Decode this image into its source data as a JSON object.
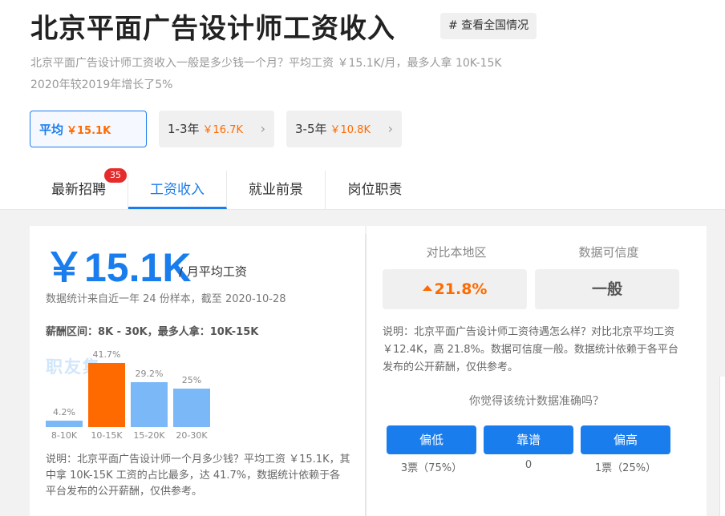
{
  "header": {
    "title": "北京平面广告设计师工资收入",
    "nation_tag": "# 查看全国情况",
    "desc_line1": "北京平面广告设计师工资收入一般是多少钱一个月？平均工资 ￥15.1K/月，最多人拿 10K-15K",
    "desc_line2": "2020年较2019年增长了5%"
  },
  "chips": [
    {
      "label": "平均",
      "value": "￥15.1K"
    },
    {
      "label": "1-3年",
      "value": "￥16.7K"
    },
    {
      "label": "3-5年",
      "value": "￥10.8K"
    }
  ],
  "tabs": [
    {
      "label": "最新招聘",
      "badge": "35"
    },
    {
      "label": "工资收入"
    },
    {
      "label": "就业前景"
    },
    {
      "label": "岗位职责"
    }
  ],
  "salary": {
    "amount": "￥15.1K",
    "unit": "/ 月平均工资",
    "sample_note": "数据统计来自近一年 24 份样本，截至 2020-10-28",
    "range_label": "薪酬区间：8K - 30K，最多人拿：10K-15K",
    "watermark": "职友集",
    "desc": "说明：北京平面广告设计师一个月多少钱？平均工资 ￥15.1K，其中拿 10K-15K 工资的占比最多，达 41.7%，数据统计依赖于各平台发布的公开薪酬，仅供参考。"
  },
  "chart_data": {
    "type": "bar",
    "categories": [
      "8-10K",
      "10-15K",
      "15-20K",
      "20-30K"
    ],
    "values": [
      4.2,
      41.7,
      29.2,
      25
    ],
    "labels": [
      "4.2%",
      "41.7%",
      "29.2%",
      "25%"
    ],
    "highlight_index": 1,
    "colors": {
      "normal": "#7ab8f8",
      "highlight": "#ff6a00"
    },
    "ylim": [
      0,
      41.7
    ]
  },
  "compare": {
    "region_title": "对比本地区",
    "region_value": "21.8%",
    "trust_title": "数据可信度",
    "trust_value": "一般",
    "desc": "说明：北京平面广告设计师工资待遇怎么样？对比北京平均工资 ￥12.4K，高 21.8%。数据可信度一般。数据统计依赖于各平台发布的公开薪酬，仅供参考。"
  },
  "vote": {
    "question": "你觉得该统计数据准确吗？",
    "options": [
      {
        "label": "偏低",
        "count": "3票（75%）"
      },
      {
        "label": "靠谱",
        "count": "0"
      },
      {
        "label": "偏高",
        "count": "1票（25%）"
      }
    ]
  },
  "colors": {
    "accent": "#1a7dee",
    "orange": "#ff6a00",
    "badge": "#e52c2c"
  }
}
